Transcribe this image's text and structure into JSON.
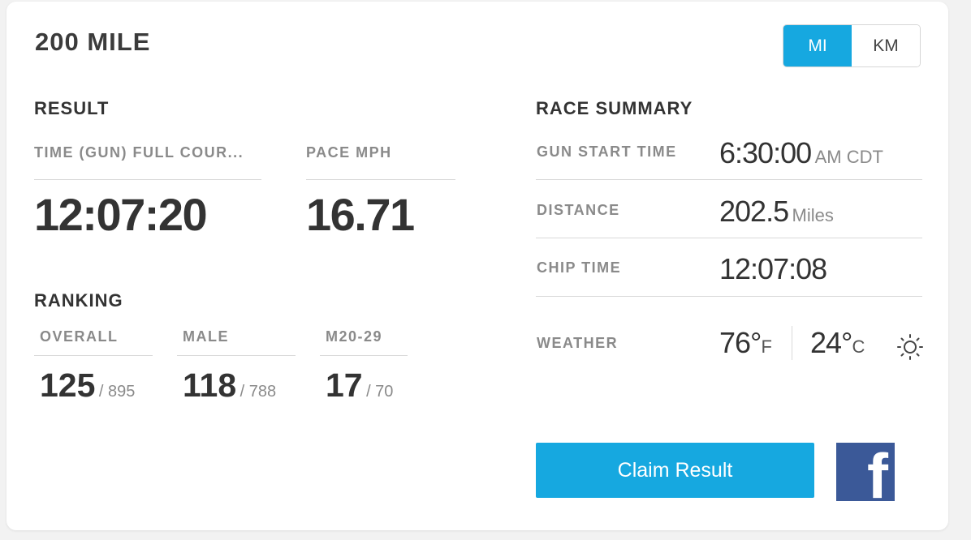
{
  "race": {
    "title": "200 MILE"
  },
  "units": {
    "mi_label": "MI",
    "km_label": "KM",
    "active": "MI"
  },
  "result": {
    "heading": "RESULT",
    "time_label": "TIME (GUN) FULL COUR...",
    "time_value": "12:07:20",
    "pace_label": "PACE MPH",
    "pace_value": "16.71"
  },
  "ranking": {
    "heading": "RANKING",
    "items": [
      {
        "label": "OVERALL",
        "rank": "125",
        "total": "/ 895"
      },
      {
        "label": "MALE",
        "rank": "118",
        "total": "/ 788"
      },
      {
        "label": "M20-29",
        "rank": "17",
        "total": "/ 70"
      }
    ]
  },
  "summary": {
    "heading": "RACE SUMMARY",
    "gun_start_label": "GUN START TIME",
    "gun_start_value": "6:30:00",
    "gun_start_suffix": "AM CDT",
    "distance_label": "DISTANCE",
    "distance_value": "202.5",
    "distance_unit": "Miles",
    "chip_label": "CHIP TIME",
    "chip_value": "12:07:08",
    "weather_label": "WEATHER",
    "temp_f": "76°",
    "temp_f_unit": "F",
    "temp_c": "24°",
    "temp_c_unit": "C",
    "weather_icon": "sun-icon"
  },
  "actions": {
    "claim_label": "Claim Result",
    "share_icon": "facebook-icon"
  },
  "colors": {
    "accent": "#16a8e0",
    "facebook": "#3b5998"
  }
}
